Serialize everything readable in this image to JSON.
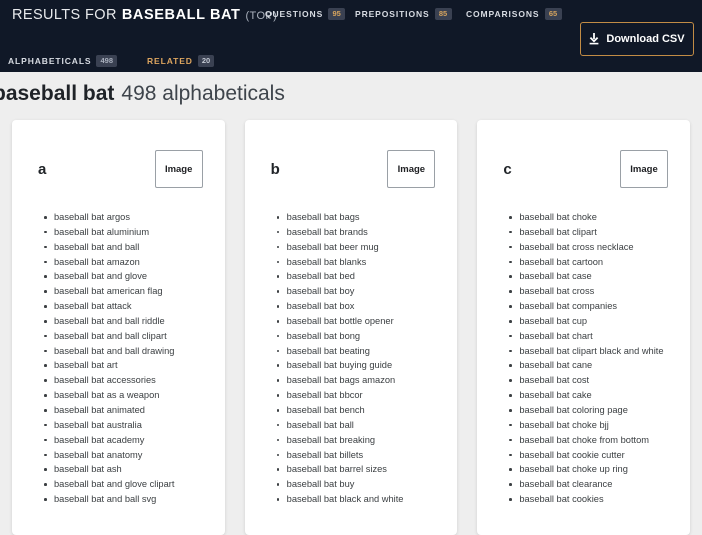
{
  "header": {
    "results_prefix": "RESULTS FOR",
    "results_term": "BASEBALL BAT",
    "results_suffix": "(TOP)",
    "metrics": [
      {
        "label": "QUESTIONS",
        "count": "95"
      },
      {
        "label": "PREPOSITIONS",
        "count": "85"
      },
      {
        "label": "COMPARISONS",
        "count": "65"
      }
    ],
    "tabs": [
      {
        "label": "ALPHABETICALS",
        "count": "498",
        "active": false
      },
      {
        "label": "RELATED",
        "count": "20",
        "active": true
      }
    ],
    "download_label": "Download CSV",
    "download_icon": "download-icon",
    "accent_color": "#dda55f",
    "background_color": "#101827"
  },
  "page": {
    "heading_term": "baseball bat",
    "heading_rest": "498 alphabeticals"
  },
  "cards": [
    {
      "letter": "a",
      "image_label": "Image",
      "items": [
        "baseball bat argos",
        "baseball bat aluminium",
        "baseball bat and ball",
        "baseball bat amazon",
        "baseball bat and glove",
        "baseball bat american flag",
        "baseball bat attack",
        "baseball bat and ball riddle",
        "baseball bat and ball clipart",
        "baseball bat and ball drawing",
        "baseball bat art",
        "baseball bat accessories",
        "baseball bat as a weapon",
        "baseball bat animated",
        "baseball bat australia",
        "baseball bat academy",
        "baseball bat anatomy",
        "baseball bat ash",
        "baseball bat and glove clipart",
        "baseball bat and ball svg"
      ]
    },
    {
      "letter": "b",
      "image_label": "Image",
      "items": [
        "baseball bat bags",
        "baseball bat brands",
        "baseball bat beer mug",
        "baseball bat blanks",
        "baseball bat bed",
        "baseball bat boy",
        "baseball bat box",
        "baseball bat bottle opener",
        "baseball bat bong",
        "baseball bat beating",
        "baseball bat buying guide",
        "baseball bat bags amazon",
        "baseball bat bbcor",
        "baseball bat bench",
        "baseball bat ball",
        "baseball bat breaking",
        "baseball bat billets",
        "baseball bat barrel sizes",
        "baseball bat buy",
        "baseball bat black and white"
      ]
    },
    {
      "letter": "c",
      "image_label": "Image",
      "items": [
        "baseball bat choke",
        "baseball bat clipart",
        "baseball bat cross necklace",
        "baseball bat cartoon",
        "baseball bat case",
        "baseball bat cross",
        "baseball bat companies",
        "baseball bat cup",
        "baseball bat chart",
        "baseball bat clipart black and white",
        "baseball bat cane",
        "baseball bat cost",
        "baseball bat cake",
        "baseball bat coloring page",
        "baseball bat choke bjj",
        "baseball bat choke from bottom",
        "baseball bat cookie cutter",
        "baseball bat choke up ring",
        "baseball bat clearance",
        "baseball bat cookies"
      ]
    }
  ]
}
